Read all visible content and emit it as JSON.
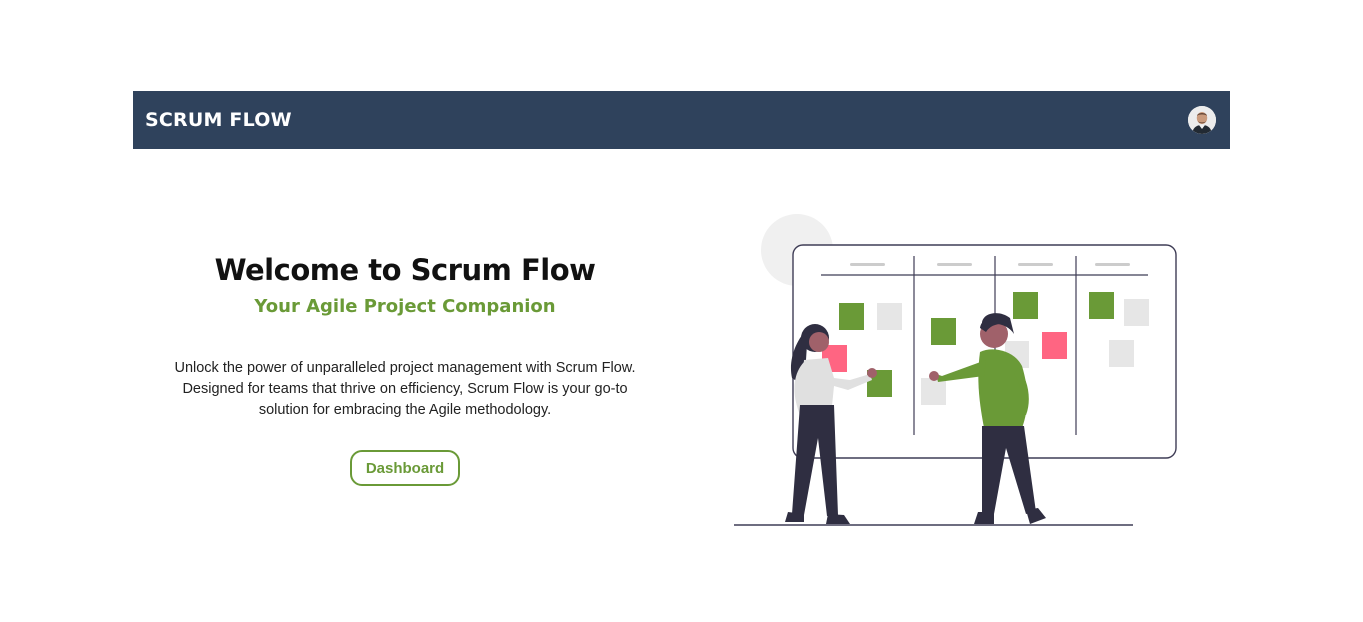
{
  "navbar": {
    "brand": "SCRUM FLOW",
    "avatar_icon": "user-avatar"
  },
  "hero": {
    "title": "Welcome to Scrum Flow",
    "subtitle": "Your Agile Project Companion",
    "description": "Unlock the power of unparalleled project management with Scrum Flow. Designed for teams that thrive on efficiency, Scrum Flow is your go-to solution for embracing the Agile methodology.",
    "button_label": "Dashboard"
  },
  "colors": {
    "navbar_bg": "#2f425c",
    "accent_green": "#6a9a37",
    "note_pink": "#ff6582",
    "note_gray": "#e6e6e6"
  }
}
